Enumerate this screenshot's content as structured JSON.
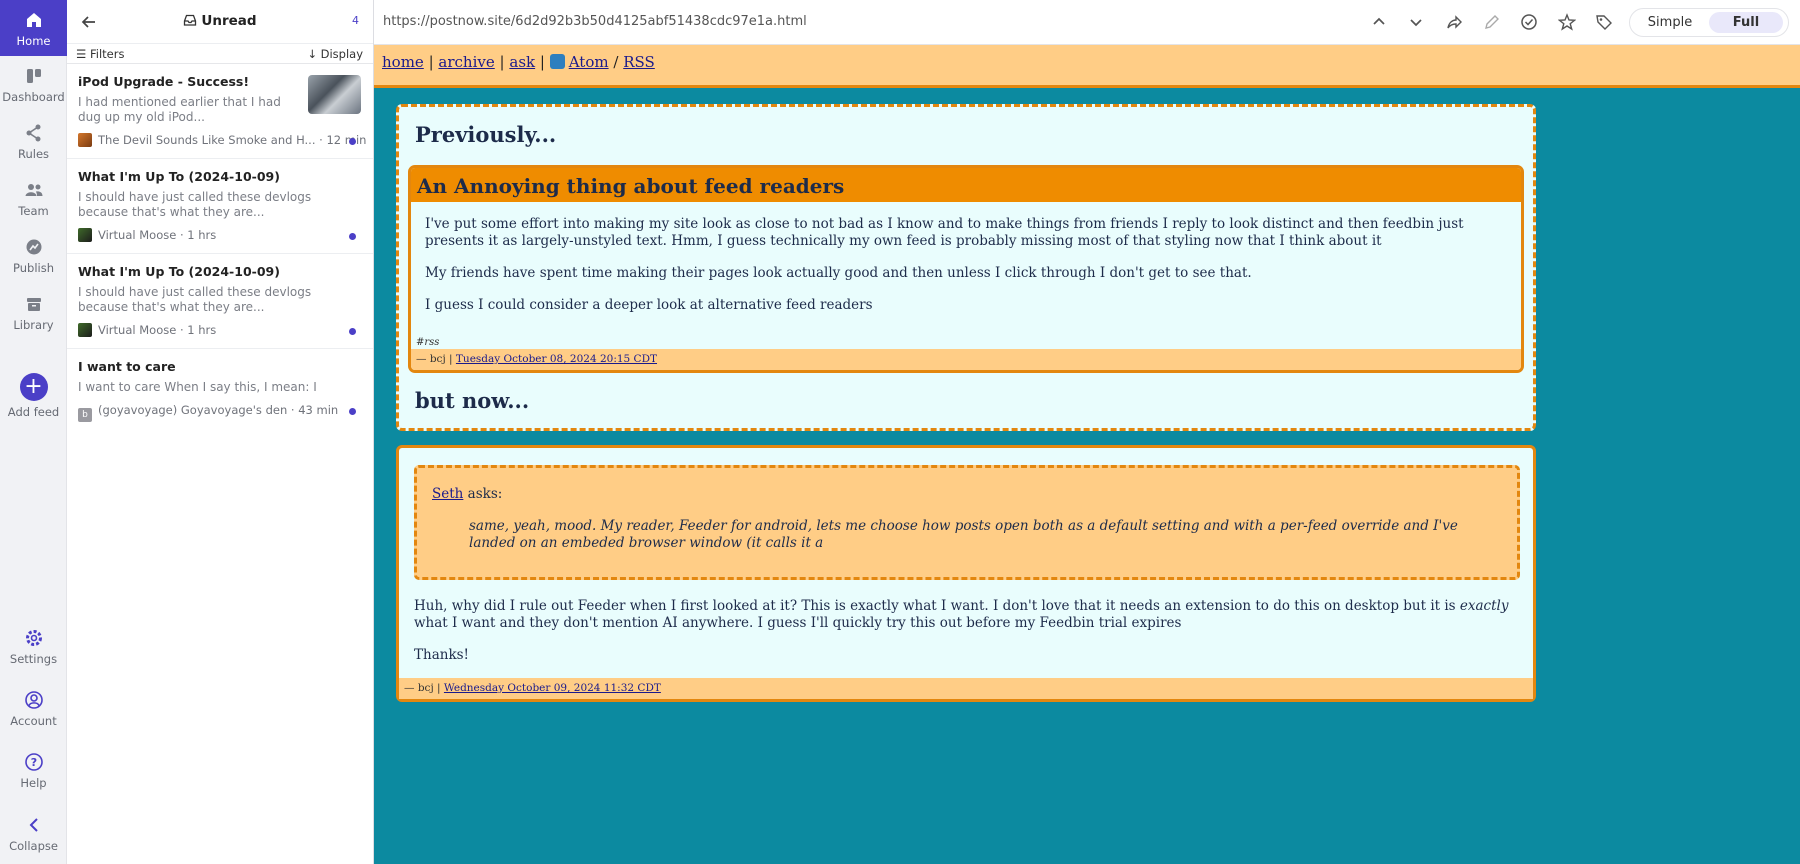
{
  "nav": {
    "items": [
      {
        "label": "Home",
        "icon": "home-icon"
      },
      {
        "label": "Dashboard",
        "icon": "dashboard-icon"
      },
      {
        "label": "Rules",
        "icon": "share-icon"
      },
      {
        "label": "Team",
        "icon": "team-icon"
      },
      {
        "label": "Publish",
        "icon": "publish-icon"
      },
      {
        "label": "Library",
        "icon": "archive-icon"
      },
      {
        "label": "Add feed",
        "icon": "plus-icon"
      }
    ],
    "bottom": [
      {
        "label": "Settings",
        "icon": "gear-icon"
      },
      {
        "label": "Account",
        "icon": "user-icon"
      },
      {
        "label": "Help",
        "icon": "help-icon"
      },
      {
        "label": "Collapse",
        "icon": "chevron-left-icon"
      }
    ]
  },
  "list": {
    "title": "Unread",
    "count": "4",
    "filters_label": "Filters",
    "display_label": "Display",
    "entries": [
      {
        "title": "iPod Upgrade - Success!",
        "summary": "I had mentioned earlier that I had dug up my old iPod...",
        "source": "The Devil Sounds Like Smoke and H...",
        "time": "12 min"
      },
      {
        "title": "What I'm Up To (2024-10-09)",
        "summary": "I should have just called these devlogs because that's what they are...",
        "source": "Virtual Moose",
        "time": "1 hrs"
      },
      {
        "title": "What I'm Up To (2024-10-09)",
        "summary": "I should have just called these devlogs because that's what they are...",
        "source": "Virtual Moose",
        "time": "1 hrs"
      },
      {
        "title": "I want to care",
        "summary": "I want to care When I say this, I mean: I want...",
        "source": "(goyavoyage) Goyavoyage's den",
        "time": "43 min"
      }
    ]
  },
  "reader": {
    "url": "https://postnow.site/6d2d92b3b50d4125abf51438cdc97e1a.html",
    "mode_simple": "Simple",
    "mode_full": "Full"
  },
  "site": {
    "nav": {
      "home": "home",
      "archive": "archive",
      "ask": "ask",
      "atom": "Atom",
      "rss": "RSS",
      "sep": "|",
      "slash": "/"
    },
    "previously": "Previously...",
    "inner_title": "An Annoying thing about feed readers",
    "inner_p1": "I've put some effort into making my site look as close to not bad as I know and to make things from friends I reply to look distinct and then feedbin just presents it as largely-unstyled text. Hmm, I guess technically my own feed is probably missing most of that styling now that I think about it",
    "inner_p2": "My friends have spent time making their pages look actually good and then unless I click through I don't get to see that.",
    "inner_p3": "I guess I could consider a deeper look at alternative feed readers",
    "inner_tag": "#rss",
    "inner_author": "— bcj |",
    "inner_date": "Tuesday October 08, 2024 20:15 CDT",
    "but_now": "but now...",
    "asker": "Seth",
    "asks": "asks:",
    "quote": "same, yeah, mood. My reader, Feeder for android, lets me choose how posts open both as a default setting and with a per-feed override and I've landed on an embeded browser window (it calls it a",
    "answer_pre": "Huh, why did I rule out Feeder when I first looked at it? This is exactly what I want. I don't love that it needs an extension to do this on desktop but it is",
    "answer_em": "exactly",
    "answer_post": "what I want and they don't mention AI anywhere. I guess I'll quickly try this out before my Feedbin trial expires",
    "thanks": "Thanks!",
    "post_author": "— bcj |",
    "post_date": "Wednesday October 09, 2024 11:32 CDT"
  },
  "colors": {
    "accent": "#4b3fc7",
    "reader_bg": "#0c8aa0",
    "site_orange": "#ef8c00",
    "site_peach": "#ffcd86",
    "site_panel": "#e9fdfd"
  }
}
